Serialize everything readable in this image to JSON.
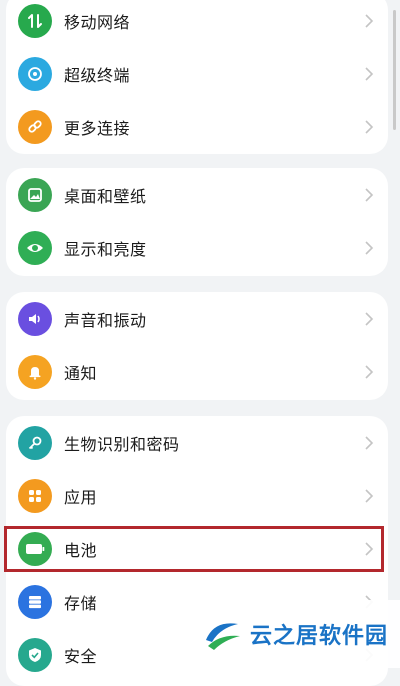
{
  "groups": [
    {
      "items": [
        {
          "label": "移动网络",
          "icon": "mobile-data-icon",
          "color": "#27a94d"
        },
        {
          "label": "超级终端",
          "icon": "super-device-icon",
          "color": "#2ba9e0"
        },
        {
          "label": "更多连接",
          "icon": "link-icon",
          "color": "#f39a1f"
        }
      ]
    },
    {
      "items": [
        {
          "label": "桌面和壁纸",
          "icon": "wallpaper-icon",
          "color": "#3aa554"
        },
        {
          "label": "显示和亮度",
          "icon": "eye-icon",
          "color": "#2fae55"
        }
      ]
    },
    {
      "items": [
        {
          "label": "声音和振动",
          "icon": "speaker-icon",
          "color": "#6a4fe0"
        },
        {
          "label": "通知",
          "icon": "bell-icon",
          "color": "#f5a322"
        }
      ]
    },
    {
      "items": [
        {
          "label": "生物识别和密码",
          "icon": "key-icon",
          "color": "#22a3a3"
        },
        {
          "label": "应用",
          "icon": "apps-icon",
          "color": "#f39a1f"
        },
        {
          "label": "电池",
          "icon": "battery-icon",
          "color": "#34ac52"
        },
        {
          "label": "存储",
          "icon": "storage-icon",
          "color": "#2b73e0"
        },
        {
          "label": "安全",
          "icon": "shield-icon",
          "color": "#26a88e"
        }
      ]
    }
  ],
  "highlighted_item": "电池",
  "colors": {
    "highlight_border": "#b3282d",
    "background": "#f1f3f5",
    "watermark": "#1a73c6"
  },
  "watermark": {
    "text": "云之居软件园"
  }
}
